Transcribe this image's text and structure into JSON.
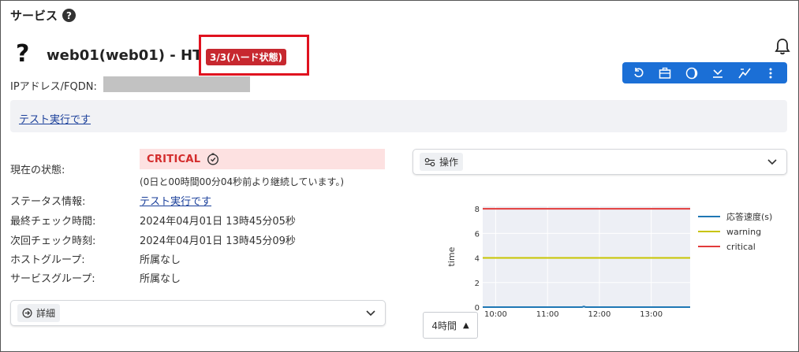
{
  "page": {
    "title": "サービス"
  },
  "service": {
    "status_symbol": "?",
    "name": "web01(web01) - HTTP",
    "hard_state": "3/3(ハード状態)",
    "ip_label": "IPアドレス/FQDN:"
  },
  "output": {
    "text": "テスト実行です"
  },
  "details": {
    "current_state_label": "現在の状態:",
    "current_state_value": "CRITICAL",
    "duration_text": "(0日と00時間00分04秒前より継続しています。)",
    "status_info_label": "ステータス情報:",
    "status_info_value": "テスト実行です",
    "last_check_label": "最終チェック時間:",
    "last_check_value": "2024年04月01日 13時45分05秒",
    "next_check_label": "次回チェック時刻:",
    "next_check_value": "2024年04月01日 13時45分09秒",
    "host_group_label": "ホストグループ:",
    "host_group_value": "所属なし",
    "service_group_label": "サービスグループ:",
    "service_group_value": "所属なし"
  },
  "detail_panel": {
    "label": "詳細"
  },
  "operation_panel": {
    "label": "操作"
  },
  "toolbar": {
    "icons": [
      "undo-icon",
      "briefcase-icon",
      "moon-icon",
      "download-icon",
      "graph-icon",
      "more-vertical-icon"
    ]
  },
  "time_range": {
    "label": "4時間"
  },
  "colors": {
    "accent": "#1b6fd6",
    "critical": "#d32c2c",
    "hard_badge": "#c7282f",
    "warning_line": "#c8c400",
    "critical_line": "#e23b3b",
    "response_line": "#1f77b4"
  },
  "chart_data": {
    "type": "line",
    "ylabel": "time",
    "xlabel": "",
    "x_ticks": [
      "10:00",
      "11:00",
      "12:00",
      "13:00"
    ],
    "ylim": [
      0,
      8.2
    ],
    "y_ticks": [
      0,
      2,
      4,
      6,
      8
    ],
    "x_range": [
      "09:45",
      "13:45"
    ],
    "grid": true,
    "legend": "right",
    "series": [
      {
        "name": "応答速度(s)",
        "color": "#1f77b4",
        "x": [
          "09:45",
          "11:40",
          "11:42",
          "11:44",
          "13:45"
        ],
        "values": [
          0,
          0,
          0.05,
          0,
          0
        ]
      },
      {
        "name": "warning",
        "color": "#c8c400",
        "x": [
          "09:45",
          "13:45"
        ],
        "values": [
          4,
          4
        ]
      },
      {
        "name": "critical",
        "color": "#e23b3b",
        "x": [
          "09:45",
          "13:45"
        ],
        "values": [
          8,
          8
        ]
      }
    ]
  }
}
